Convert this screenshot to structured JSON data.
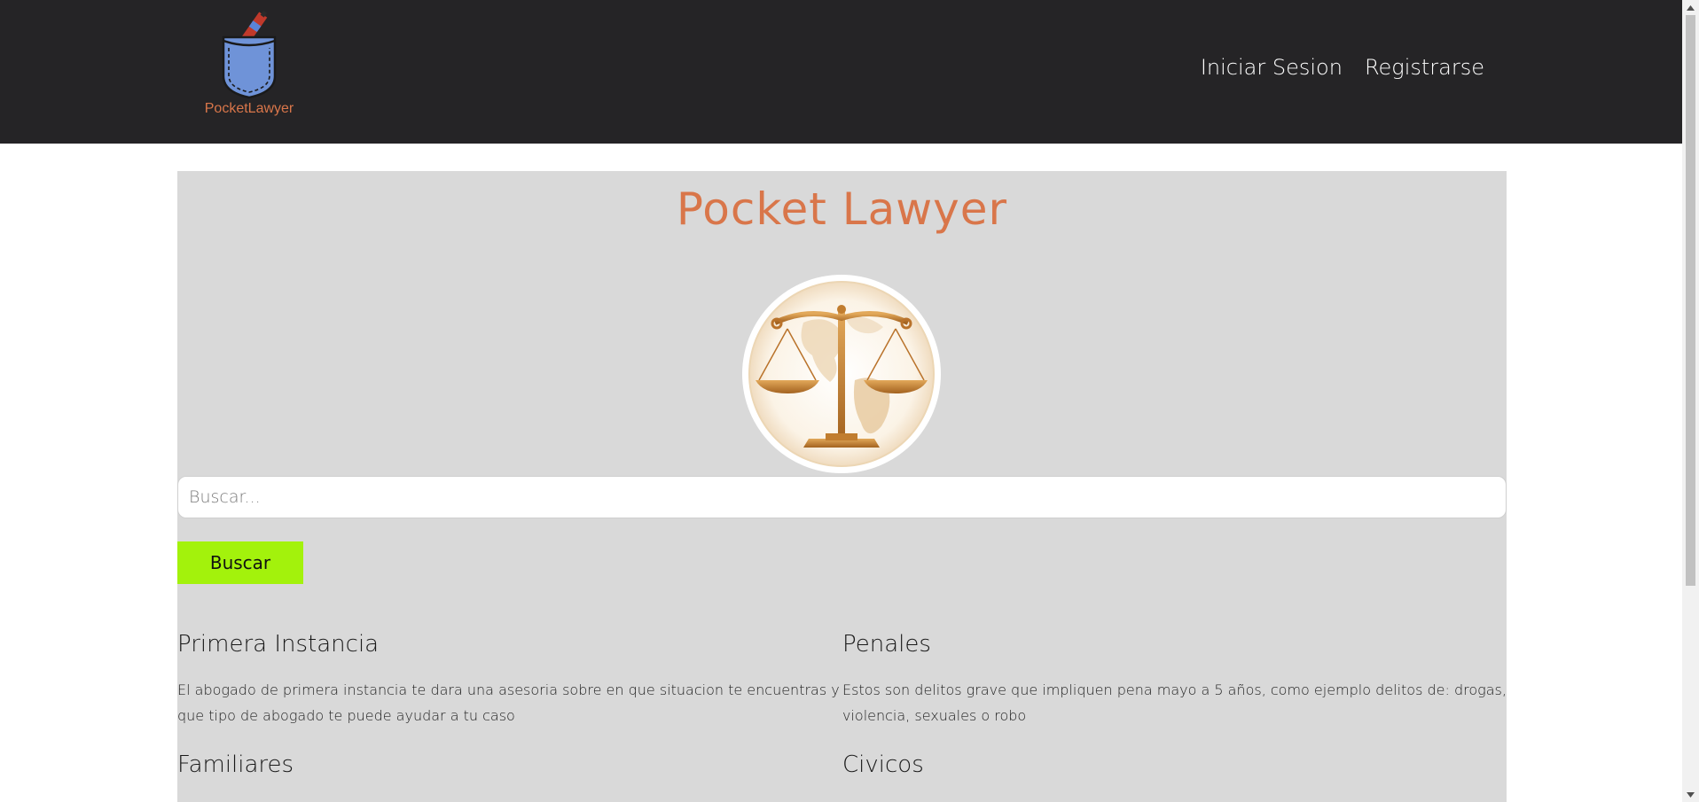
{
  "header": {
    "logo_text": "PocketLawyer",
    "nav": [
      {
        "label": "Iniciar Sesion"
      },
      {
        "label": "Registrarse"
      }
    ]
  },
  "main": {
    "title": "Pocket Lawyer",
    "search": {
      "placeholder": "Buscar...",
      "value": "",
      "button_label": "Buscar"
    },
    "categories": [
      {
        "title": "Primera Instancia",
        "description": "El abogado de primera instancia te dara una asesoria sobre en que situacion te encuentras y que tipo de abogado te puede ayudar a tu caso"
      },
      {
        "title": "Penales",
        "description": "Estos son delitos grave que impliquen pena mayo a 5 años, como ejemplo delitos de: drogas, violencia, sexuales o robo"
      },
      {
        "title": "Familiares",
        "description": ""
      },
      {
        "title": "Civicos",
        "description": ""
      }
    ]
  },
  "colors": {
    "navbar_bg": "#252426",
    "accent": "#d9764a",
    "panel_bg": "#d9d9d9",
    "search_button_bg": "#a3f20c"
  },
  "icons": {
    "logo": "pocket-with-pen-icon",
    "emblem": "scales-of-justice-globe-icon"
  }
}
